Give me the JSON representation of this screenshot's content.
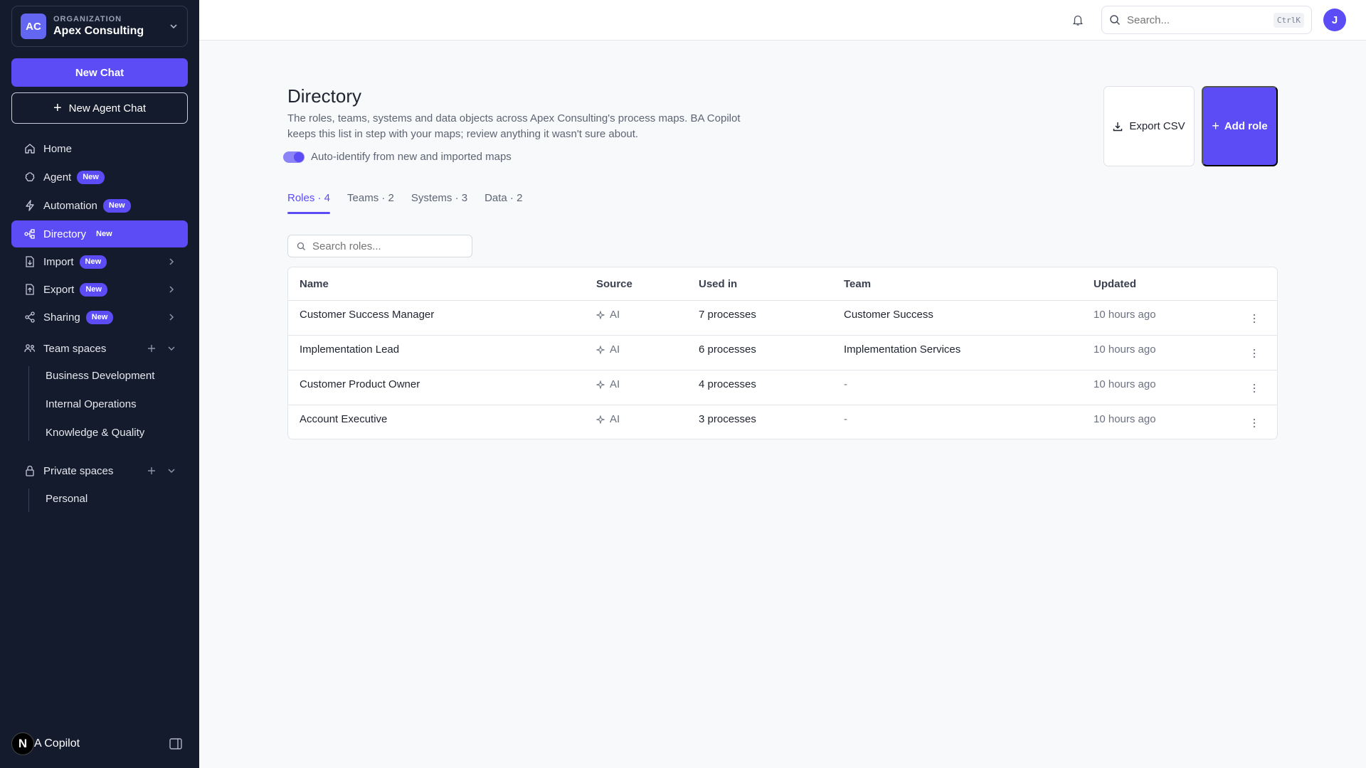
{
  "org": {
    "caption": "ORGANIZATION",
    "name": "Apex Consulting",
    "initials": "AC"
  },
  "sidebar": {
    "new_chat": "New Chat",
    "new_agent_chat": "New Agent Chat",
    "items": [
      {
        "label": "Home"
      },
      {
        "label": "Agent",
        "badge": "New"
      },
      {
        "label": "Automation",
        "badge": "New"
      },
      {
        "label": "Directory",
        "badge": "New"
      },
      {
        "label": "Import",
        "badge": "New"
      },
      {
        "label": "Export",
        "badge": "New"
      },
      {
        "label": "Sharing",
        "badge": "New"
      }
    ],
    "team_spaces": {
      "label": "Team spaces",
      "items": [
        "Business Development",
        "Internal Operations",
        "Knowledge & Quality"
      ]
    },
    "private_spaces": {
      "label": "Private spaces",
      "items": [
        "Personal"
      ]
    },
    "copilot": {
      "logo": "N",
      "name": "A Copilot"
    }
  },
  "topbar": {
    "search_placeholder": "Search...",
    "shortcut": "CtrlK",
    "user_initial": "J"
  },
  "page": {
    "title": "Directory",
    "description": "The roles, teams, systems and data objects across Apex Consulting's process maps. BA Copilot keeps this list in step with your maps; review anything it wasn't sure about.",
    "auto_identify": "Auto-identify from new and imported maps",
    "export_csv": "Export CSV",
    "add_role": "Add role",
    "tabs": [
      "Roles · 4",
      "Teams · 2",
      "Systems · 3",
      "Data · 2"
    ],
    "active_tab": "Roles · 4",
    "search_roles_placeholder": "Search roles..."
  },
  "table": {
    "columns": [
      "Name",
      "Source",
      "Used in",
      "Team",
      "Updated"
    ],
    "rows": [
      {
        "name": "Customer Success Manager",
        "source": "AI",
        "used_in": "7 processes",
        "team": "Customer Success",
        "updated": "10 hours ago"
      },
      {
        "name": "Implementation Lead",
        "source": "AI",
        "used_in": "6 processes",
        "team": "Implementation Services",
        "updated": "10 hours ago"
      },
      {
        "name": "Customer Product Owner",
        "source": "AI",
        "used_in": "4 processes",
        "team": "-",
        "updated": "10 hours ago"
      },
      {
        "name": "Account Executive",
        "source": "AI",
        "used_in": "3 processes",
        "team": "-",
        "updated": "10 hours ago"
      }
    ]
  },
  "colors": {
    "accent": "#5b4cf5",
    "sidebar_bg": "#141b2d",
    "page_bg": "#f8f9fb"
  }
}
